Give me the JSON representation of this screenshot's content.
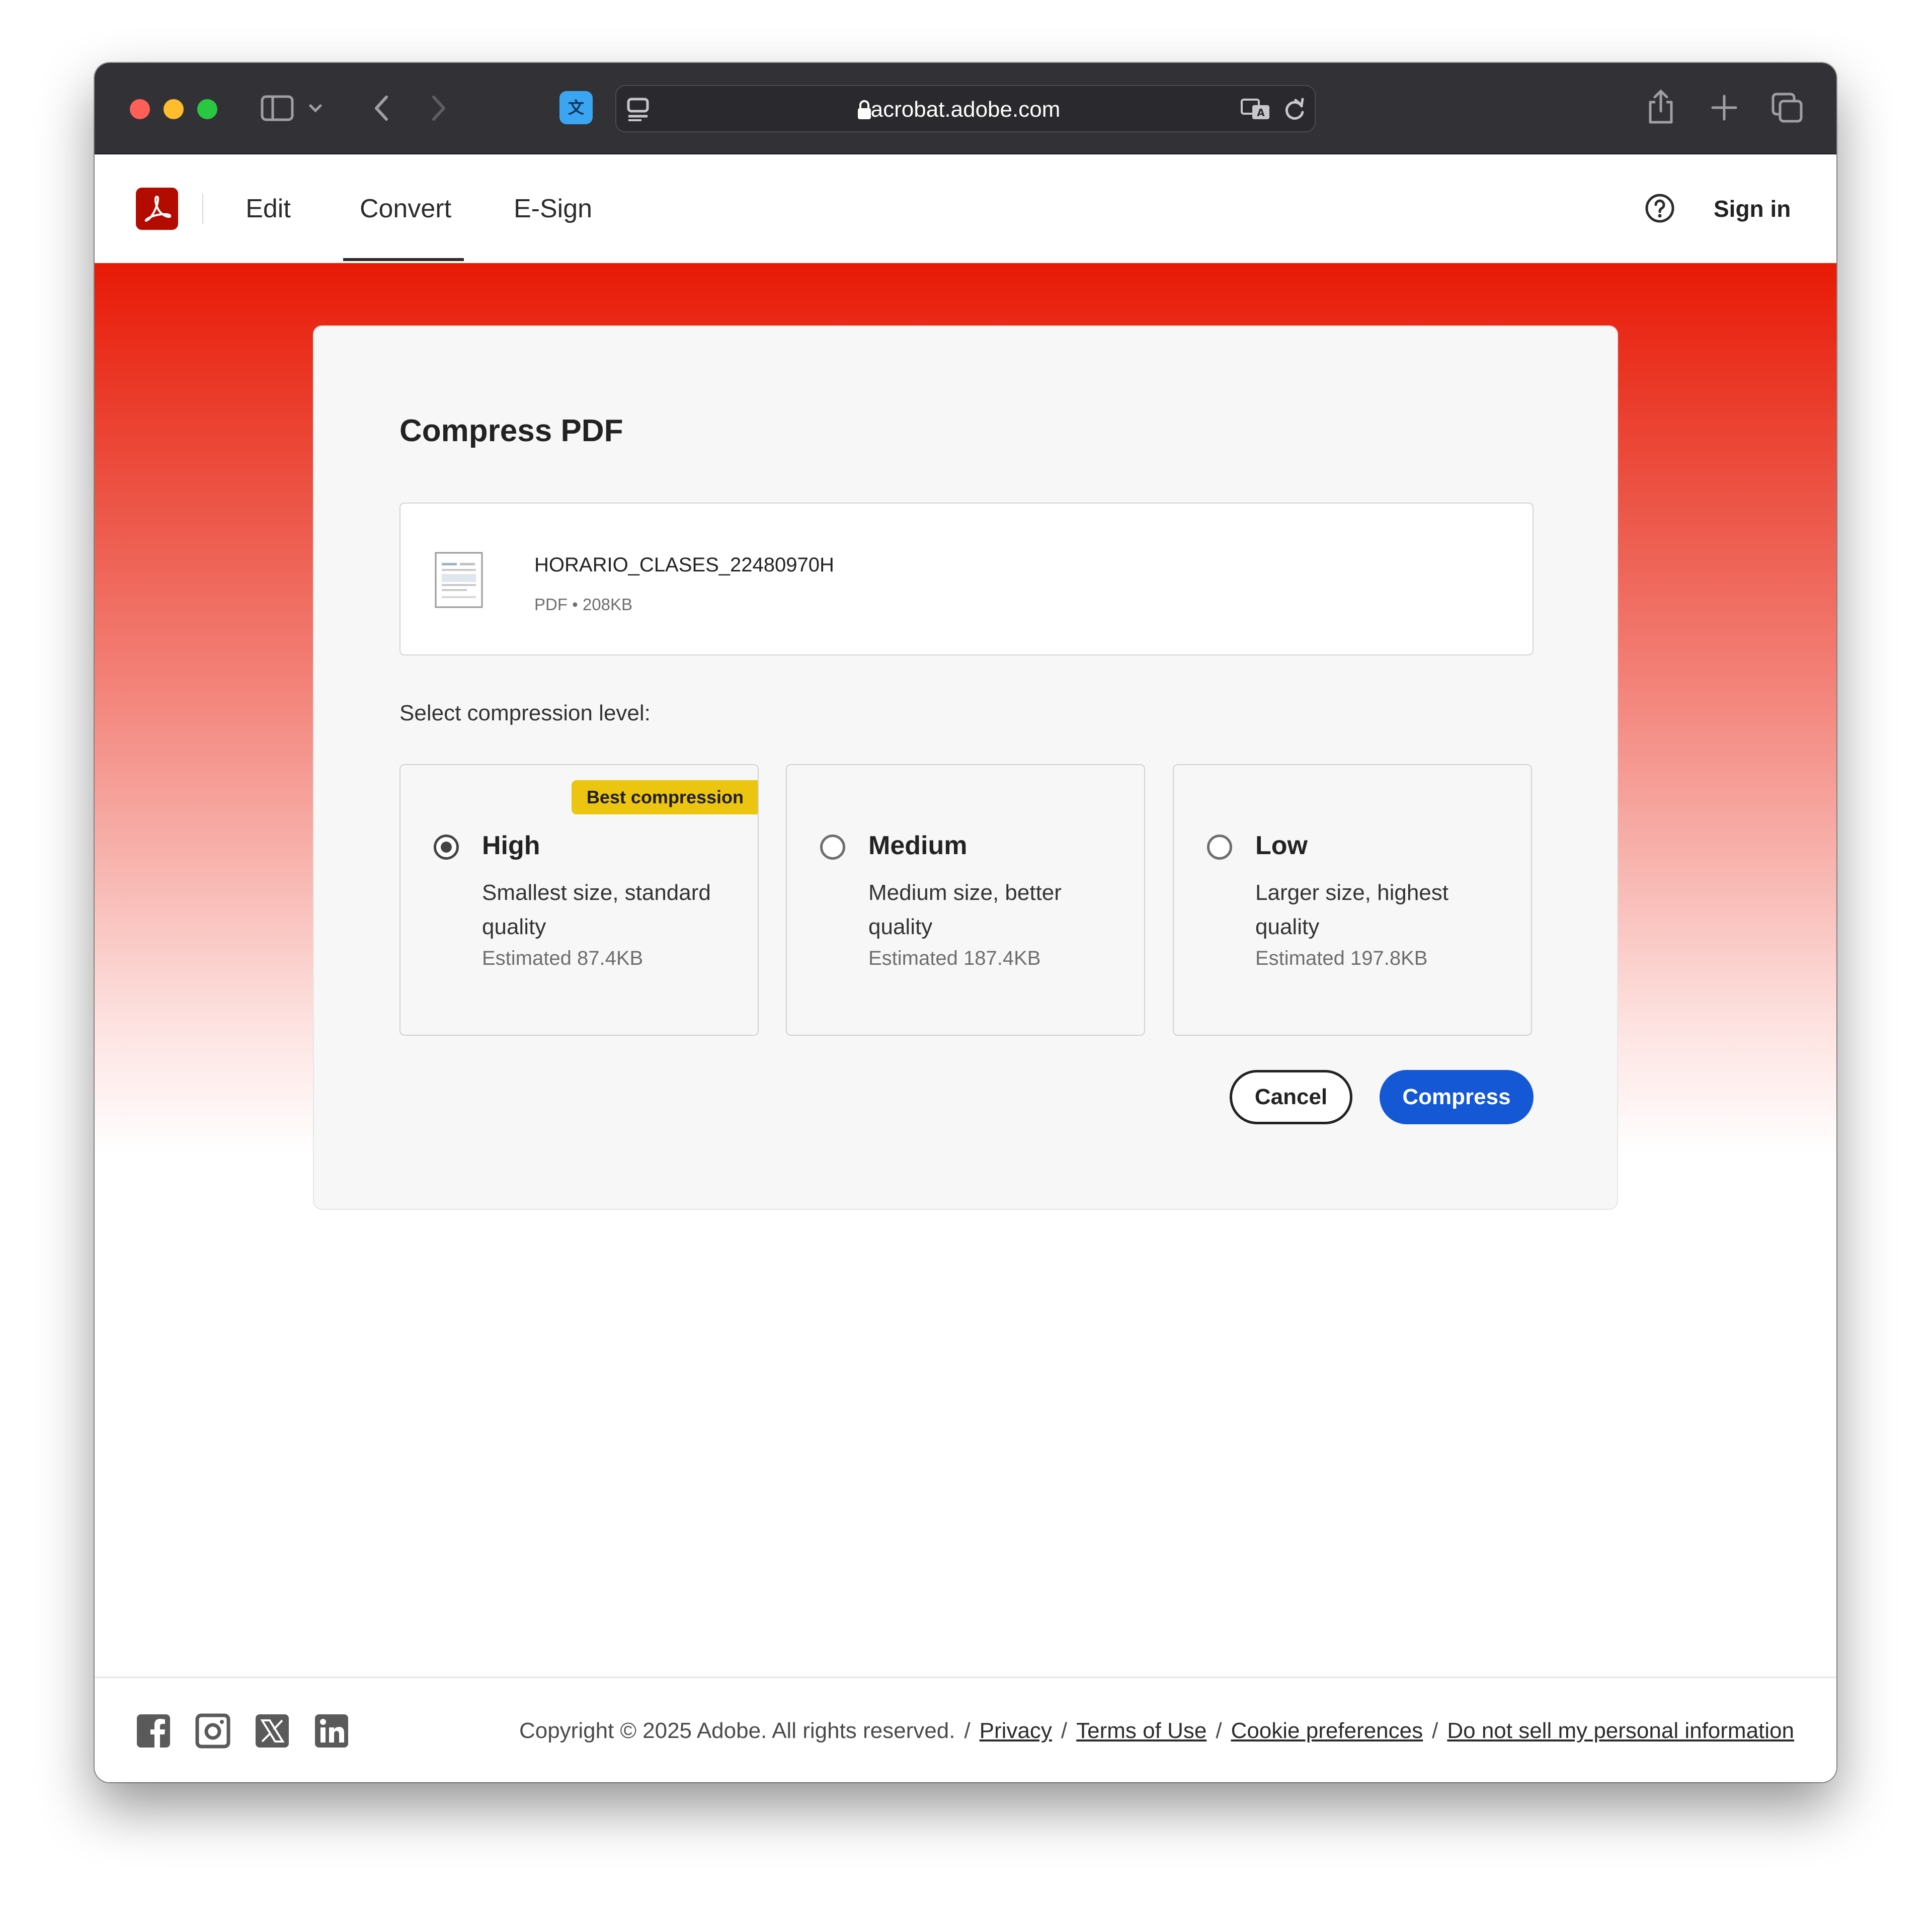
{
  "browser": {
    "address": "acrobat.adobe.com"
  },
  "nav": {
    "items": [
      {
        "label": "Edit"
      },
      {
        "label": "Convert",
        "active": true
      },
      {
        "label": "E-Sign"
      }
    ],
    "sign_in": "Sign in"
  },
  "dialog": {
    "title": "Compress PDF",
    "file": {
      "name": "HORARIO_CLASES_22480970H",
      "meta": "PDF • 208KB"
    },
    "level_label": "Select compression level:",
    "options": [
      {
        "title": "High",
        "badge": "Best compression",
        "description": "Smallest size, standard quality",
        "estimate": "Estimated 87.4KB",
        "selected": true
      },
      {
        "title": "Medium",
        "description": "Medium size, better quality",
        "estimate": "Estimated 187.4KB",
        "selected": false
      },
      {
        "title": "Low",
        "description": "Larger size, highest quality",
        "estimate": "Estimated 197.8KB",
        "selected": false
      }
    ],
    "cancel_label": "Cancel",
    "compress_label": "Compress"
  },
  "footer": {
    "copyright": "Copyright © 2025 Adobe. All rights reserved.",
    "links": [
      "Privacy",
      "Terms of Use",
      "Cookie preferences",
      "Do not sell my personal information"
    ],
    "separator": "/",
    "social_icons": [
      "facebook-icon",
      "instagram-icon",
      "x-icon",
      "linkedin-icon"
    ]
  },
  "colors": {
    "brand_red": "#e81a06",
    "primary_blue": "#1458d6",
    "badge_yellow": "#ecc511"
  }
}
